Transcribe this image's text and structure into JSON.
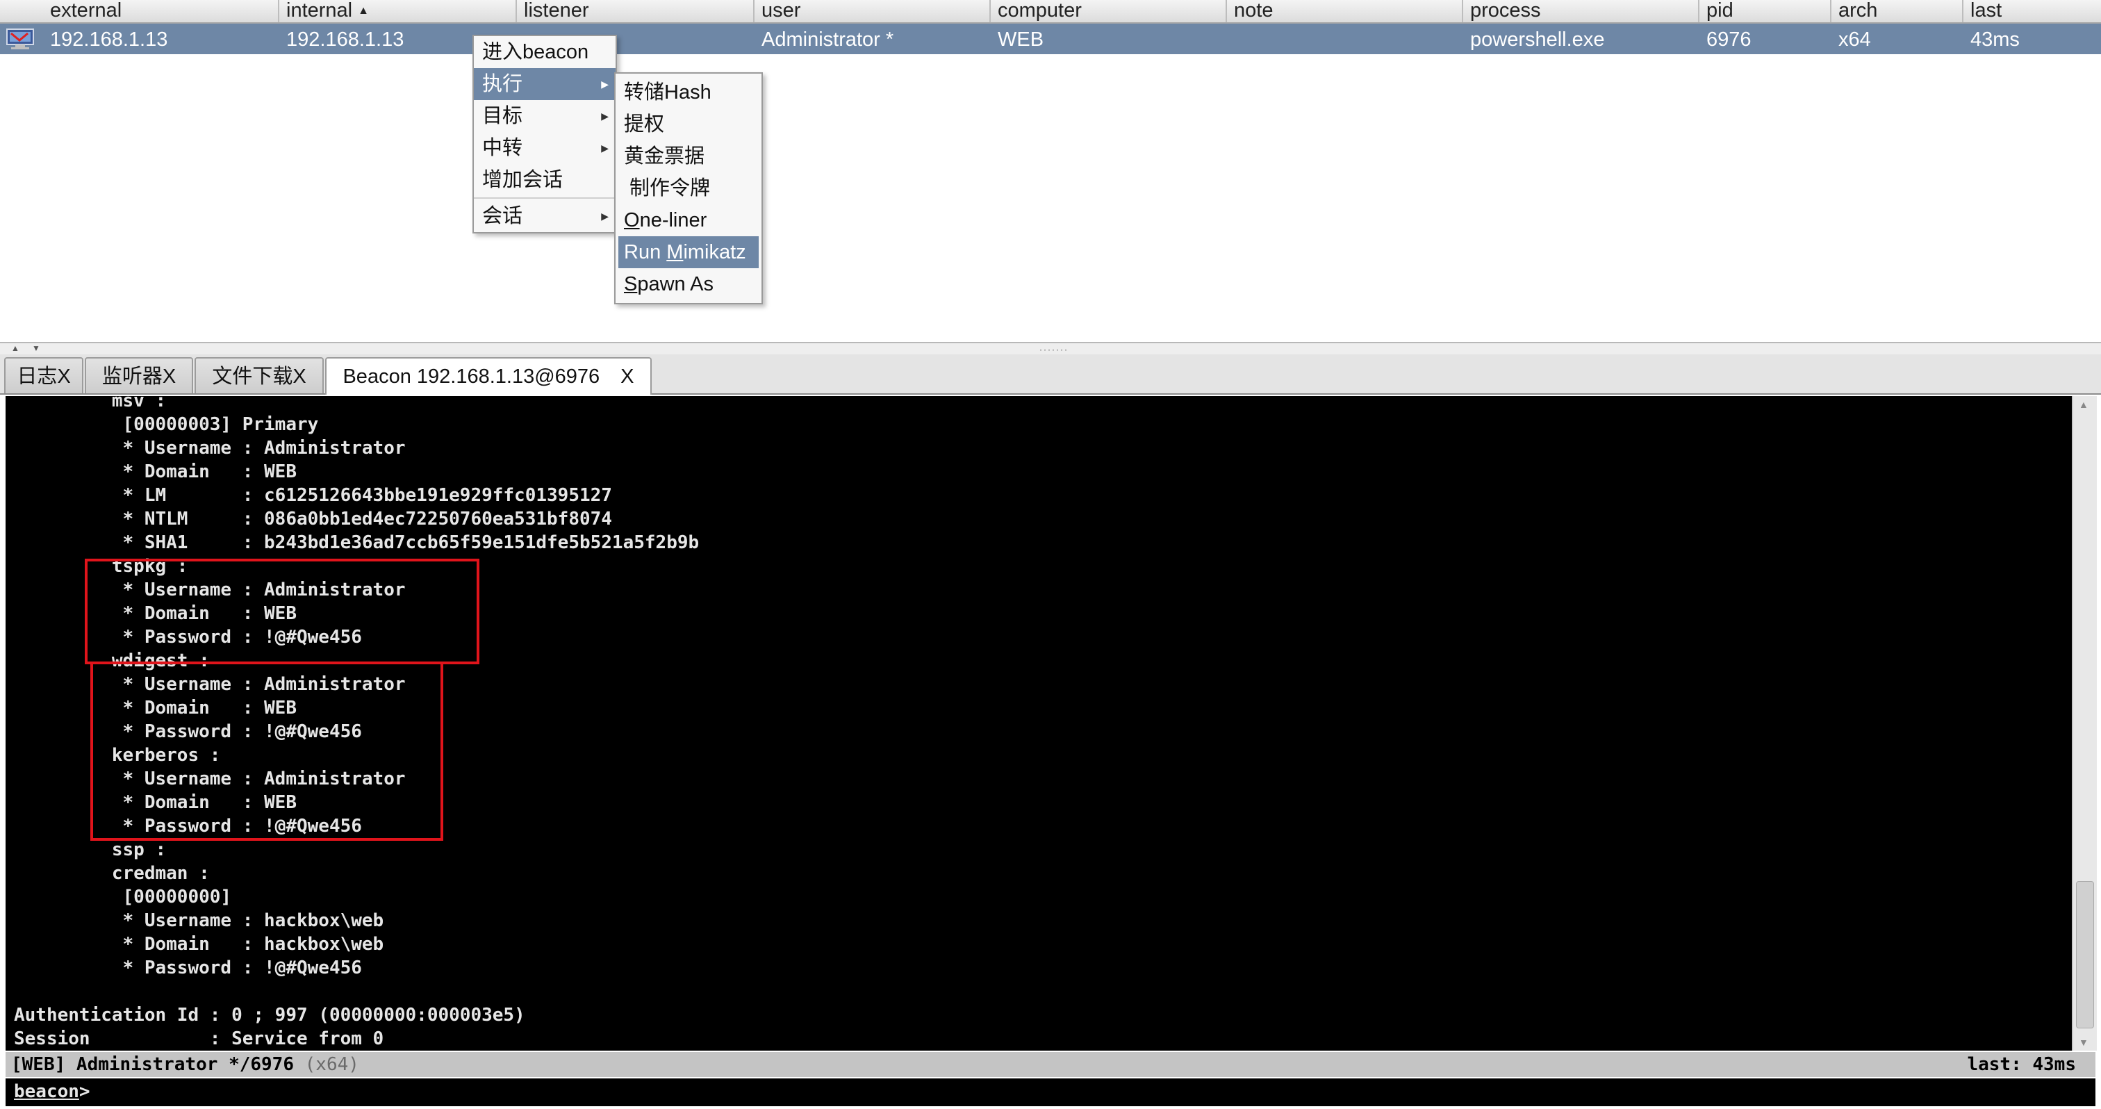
{
  "table": {
    "columns": [
      "external",
      "internal",
      "listener",
      "user",
      "computer",
      "note",
      "process",
      "pid",
      "arch",
      "last"
    ],
    "sort_column": "internal",
    "sort_direction": "ascending",
    "rows": [
      {
        "external": "192.168.1.13",
        "internal": "192.168.1.13",
        "listener": "",
        "user": "Administrator *",
        "computer": "WEB",
        "note": "",
        "process": "powershell.exe",
        "pid": "6976",
        "arch": "x64",
        "last": "43ms",
        "selected": true,
        "icon": "windows-beacon-icon"
      }
    ]
  },
  "context_menu": {
    "items": [
      {
        "label": "进入beacon",
        "has_submenu": false
      },
      {
        "label": "执行",
        "has_submenu": true,
        "highlighted": true
      },
      {
        "label": "目标",
        "has_submenu": true
      },
      {
        "label": "中转",
        "has_submenu": true
      },
      {
        "label": "增加会话",
        "has_submenu": false
      },
      {
        "label": "会话",
        "has_submenu": true
      }
    ]
  },
  "submenu": {
    "items": [
      {
        "label": "转储Hash"
      },
      {
        "label": "提权"
      },
      {
        "label": "黄金票据"
      },
      {
        "label": "制作令牌"
      },
      {
        "mnemonic": "O",
        "rest": "ne-liner"
      },
      {
        "prefix": "Run ",
        "mnemonic": "M",
        "rest": "imikatz",
        "highlighted": true
      },
      {
        "mnemonic": "S",
        "rest": "pawn As"
      }
    ]
  },
  "tabs": [
    {
      "label": "日志",
      "close": "X"
    },
    {
      "label": "监听器",
      "close": "X"
    },
    {
      "label": "文件下载",
      "close": "X"
    },
    {
      "label": "Beacon 192.168.1.13@6976",
      "close": "X",
      "active": true
    }
  ],
  "console": {
    "lines": [
      "         msv :",
      "          [00000003] Primary",
      "          * Username : Administrator",
      "          * Domain   : WEB",
      "          * LM       : c6125126643bbe191e929ffc01395127",
      "          * NTLM     : 086a0bb1ed4ec72250760ea531bf8074",
      "          * SHA1     : b243bd1e36ad7ccb65f59e151dfe5b521a5f2b9b",
      "         tspkg :",
      "          * Username : Administrator",
      "          * Domain   : WEB",
      "          * Password : !@#Qwe456",
      "         wdigest :",
      "          * Username : Administrator",
      "          * Domain   : WEB",
      "          * Password : !@#Qwe456",
      "         kerberos :",
      "          * Username : Administrator",
      "          * Domain   : WEB",
      "          * Password : !@#Qwe456",
      "         ssp :",
      "         credman :",
      "          [00000000]",
      "          * Username : hackbox\\web",
      "          * Domain   : hackbox\\web",
      "          * Password : !@#Qwe456",
      "",
      "Authentication Id : 0 ; 997 (00000000:000003e5)",
      "Session           : Service from 0"
    ],
    "highlight_color": "#e0141b"
  },
  "status": {
    "session": "[WEB] Administrator */6976",
    "arch": "(x64)",
    "last": "last: 43ms"
  },
  "prompt": {
    "label": "beacon",
    "suffix": ">",
    "value": ""
  },
  "colors": {
    "selection": "#6e87a6",
    "console_bg": "#000000",
    "console_fg": "#e6e6e6",
    "status_bg": "#c4c4c4"
  }
}
